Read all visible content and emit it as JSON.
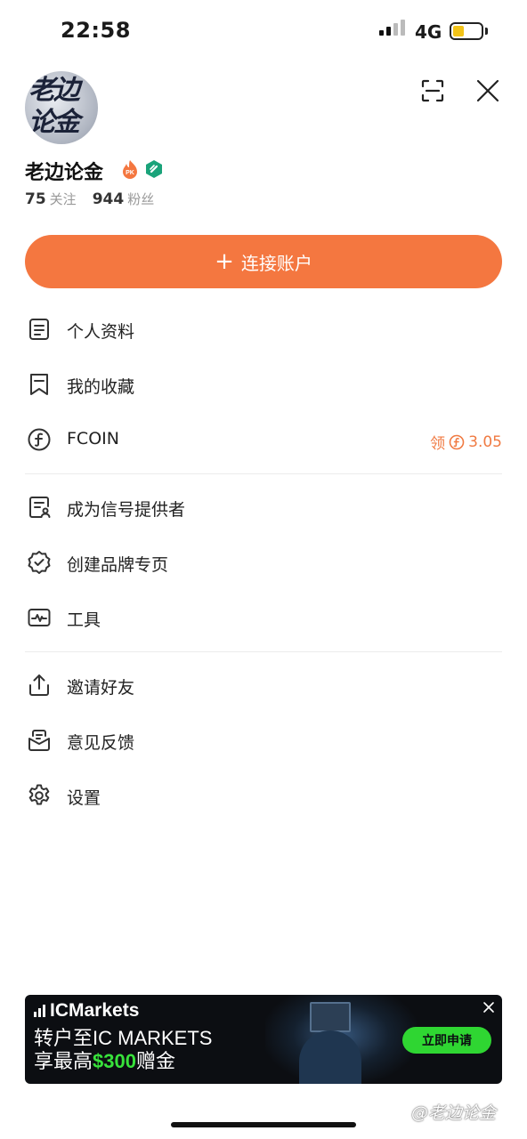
{
  "status_bar": {
    "time": "22:58",
    "network": "4G",
    "battery_level": 0.4
  },
  "profile": {
    "avatar_text": "老边论金",
    "name": "老边论金",
    "following_count": "75",
    "following_label": "关注",
    "followers_count": "944",
    "followers_label": "粉丝",
    "badge_pk_text": "PK"
  },
  "connect_button": {
    "plus": "+",
    "label": "连接账户"
  },
  "menu": {
    "group1": [
      {
        "label": "个人资料",
        "icon": "profile-doc-icon"
      },
      {
        "label": "我的收藏",
        "icon": "bookmark-icon"
      },
      {
        "label": "FCOIN",
        "icon": "fcoin-icon"
      }
    ],
    "fcoin_extra": {
      "claim_label": "领",
      "balance": "3.05"
    },
    "group2": [
      {
        "label": "成为信号提供者",
        "icon": "signal-provider-icon"
      },
      {
        "label": "创建品牌专页",
        "icon": "verified-badge-icon"
      },
      {
        "label": "工具",
        "icon": "tools-pulse-icon"
      }
    ],
    "group3": [
      {
        "label": "邀请好友",
        "icon": "share-icon"
      },
      {
        "label": "意见反馈",
        "icon": "feedback-icon"
      },
      {
        "label": "设置",
        "icon": "settings-gear-icon"
      }
    ]
  },
  "ad": {
    "brand_prefix": "IC",
    "brand_suffix": "Markets",
    "line1": "转户至IC MARKETS",
    "line2_prefix": "享最高",
    "line2_amount": "$300",
    "line2_suffix": "赠金",
    "cta": "立即申请",
    "colors": {
      "background": "#0c0e12",
      "accent": "#2fd632"
    }
  },
  "watermark": "@老边论金",
  "colors": {
    "accent": "#f47740",
    "fcoin": "#f07a42",
    "verify": "#1aa37a"
  }
}
